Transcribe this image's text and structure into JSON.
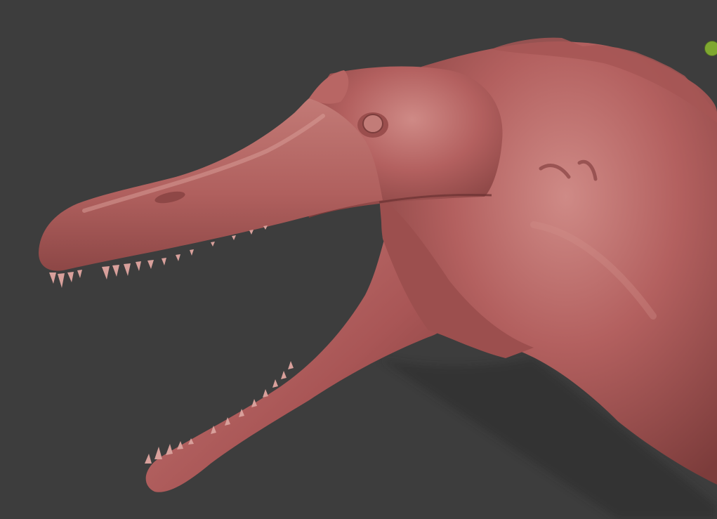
{
  "viewport": {
    "background_color": "#3d3d3d",
    "object": "sculpted-spinosaurus-head",
    "material_color": "#b3605f",
    "material_highlight": "#d08b87",
    "material_shadow": "#6f3434"
  },
  "gizmo": {
    "icon": "green-dot-icon",
    "color": "#7fa830"
  }
}
